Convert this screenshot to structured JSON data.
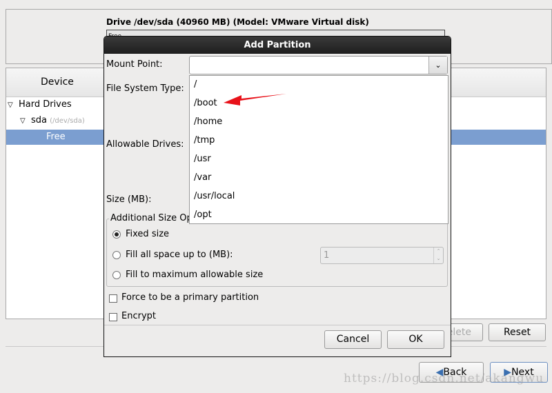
{
  "drive_header": "Drive /dev/sda (40960 MB) (Model: VMware Virtual disk)",
  "drive_bar_label": "Free",
  "device_column": "Device",
  "tree": {
    "hard_drives": "Hard Drives",
    "sda": "sda",
    "sda_path": "(/dev/sda)",
    "free": "Free"
  },
  "buttons": {
    "delete": "Delete",
    "reset": "Reset",
    "back": "Back",
    "next": "Next"
  },
  "dialog": {
    "title": "Add Partition",
    "mount_point_label": "Mount Point:",
    "mount_point_value": "",
    "fs_type_label": "File System Type:",
    "allowable_drives_label": "Allowable Drives:",
    "size_label": "Size (MB):",
    "additional_size_label": "Additional Size Options",
    "fixed_size": "Fixed size",
    "fill_up_to": "Fill all space up to (MB):",
    "fill_up_to_value": "1",
    "fill_max": "Fill to maximum allowable size",
    "force_primary": "Force to be a primary partition",
    "encrypt": "Encrypt",
    "cancel": "Cancel",
    "ok": "OK",
    "selected_size_option": "Fixed size"
  },
  "mount_options": [
    "/",
    "/boot",
    "/home",
    "/tmp",
    "/usr",
    "/var",
    "/usr/local",
    "/opt"
  ],
  "annotation_color": "#e8121a",
  "selection_color": "#7b9ed0",
  "watermark": "https://blog.csdn.net/akangwu"
}
